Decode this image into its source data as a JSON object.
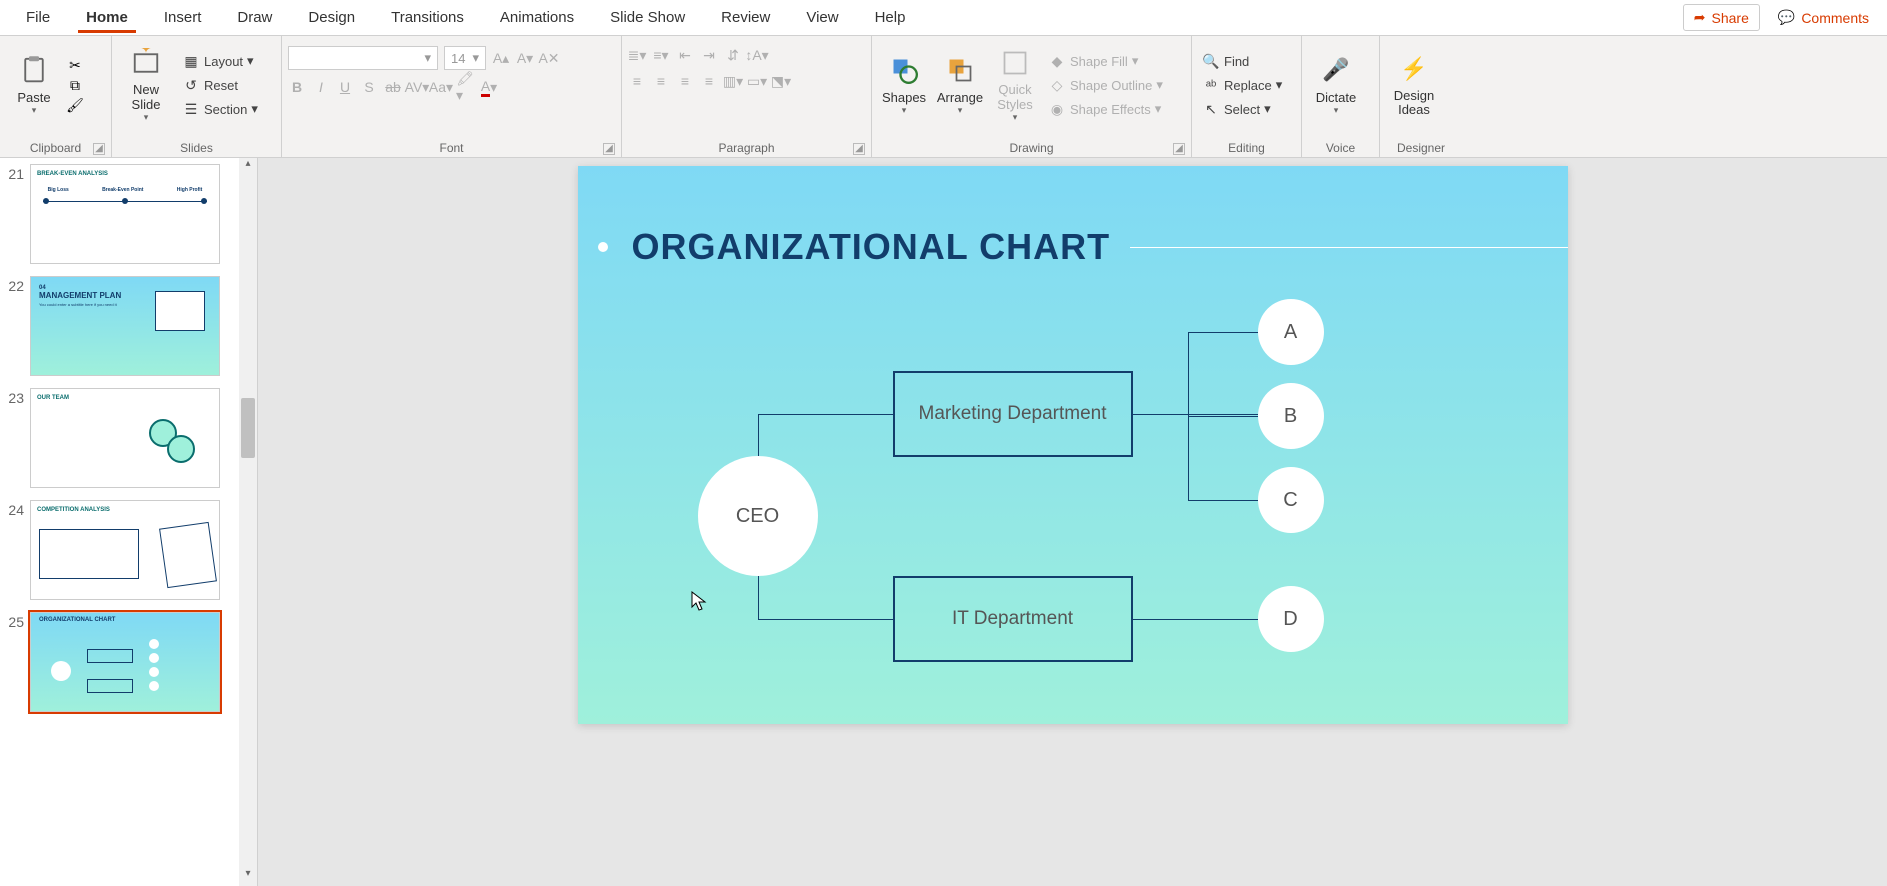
{
  "menu": {
    "tabs": [
      "File",
      "Home",
      "Insert",
      "Draw",
      "Design",
      "Transitions",
      "Animations",
      "Slide Show",
      "Review",
      "View",
      "Help"
    ],
    "share": "Share",
    "comments": "Comments"
  },
  "ribbon": {
    "clipboard": {
      "paste": "Paste",
      "label": "Clipboard"
    },
    "slides": {
      "newslide": "New Slide",
      "layout": "Layout",
      "reset": "Reset",
      "section": "Section",
      "label": "Slides"
    },
    "font": {
      "size": "14",
      "label": "Font"
    },
    "paragraph": {
      "label": "Paragraph"
    },
    "drawing": {
      "shapes": "Shapes",
      "arrange": "Arrange",
      "quickstyles": "Quick Styles",
      "shapefill": "Shape Fill",
      "shapeoutline": "Shape Outline",
      "shapeeffects": "Shape Effects",
      "label": "Drawing"
    },
    "editing": {
      "find": "Find",
      "replace": "Replace",
      "select": "Select",
      "label": "Editing"
    },
    "voice": {
      "dictate": "Dictate",
      "label": "Voice"
    },
    "designer": {
      "ideas": "Design Ideas",
      "label": "Designer"
    }
  },
  "thumbs": {
    "nums": [
      "21",
      "22",
      "23",
      "24",
      "25"
    ],
    "t21": {
      "title": "BREAK-EVEN ANALYSIS",
      "a": "Big Loss",
      "b": "Break-Even Point",
      "c": "High Profit"
    },
    "t22": {
      "num": "04",
      "title": "MANAGEMENT PLAN",
      "sub": "You could enter a subtitle here if you need it"
    },
    "t23": {
      "title": "OUR TEAM"
    },
    "t24": {
      "title": "COMPETITION ANALYSIS"
    },
    "t25": {
      "title": "ORGANIZATIONAL CHART"
    }
  },
  "slide": {
    "title": "ORGANIZATIONAL CHART",
    "ceo": "CEO",
    "mkt": "Marketing Department",
    "it": "IT Department",
    "a": "A",
    "b": "B",
    "c": "C",
    "d": "D"
  }
}
